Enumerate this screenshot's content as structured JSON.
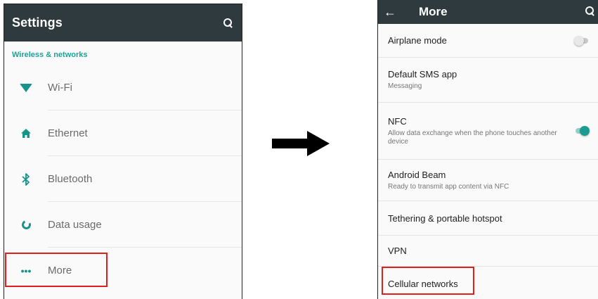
{
  "left_screen": {
    "title": "Settings",
    "search_icon": "search-icon",
    "section_header": "Wireless & networks",
    "items": [
      {
        "label": "Wi-Fi",
        "icon": "wifi-icon"
      },
      {
        "label": "Ethernet",
        "icon": "home-icon"
      },
      {
        "label": "Bluetooth",
        "icon": "bluetooth-icon"
      },
      {
        "label": "Data usage",
        "icon": "data-usage-icon"
      },
      {
        "label": "More",
        "icon": "more-dots-icon"
      }
    ],
    "highlighted_item": "More"
  },
  "arrow_icon": "right-arrow-icon",
  "right_screen": {
    "title": "More",
    "back_icon": "back-arrow-icon",
    "search_icon": "search-icon",
    "items": [
      {
        "title": "Airplane mode",
        "toggle": "off"
      },
      {
        "title": "Default SMS app",
        "subtitle": "Messaging"
      },
      {
        "title": "NFC",
        "subtitle": "Allow data exchange when the phone touches another device",
        "toggle": "on"
      },
      {
        "title": "Android Beam",
        "subtitle": "Ready to transmit app content via NFC"
      },
      {
        "title": "Tethering & portable hotspot"
      },
      {
        "title": "VPN"
      },
      {
        "title": "Cellular networks"
      }
    ],
    "highlighted_item": "Cellular networks"
  },
  "colors": {
    "app_bar": "#2f3a3e",
    "accent": "#1aa398",
    "highlight": "#e0201c"
  }
}
